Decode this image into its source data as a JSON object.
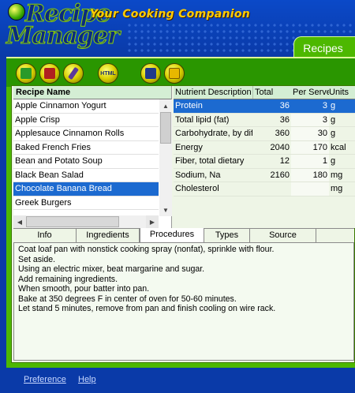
{
  "app": {
    "title_line1": "Recipe",
    "title_line2": "Manager",
    "tagline": "Your Cooking Companion",
    "tab_label": "Recipes"
  },
  "toolbar": {
    "buttons": [
      {
        "icon": "add-recipe-icon",
        "glyph_color": "#2a9a2a"
      },
      {
        "icon": "delete-recipe-icon",
        "glyph_color": "#b02020"
      },
      {
        "icon": "edit-recipe-icon",
        "glyph_color": "#5a3a9a"
      },
      {
        "icon": "html-export-icon",
        "label": "HTML"
      },
      {
        "icon": "save-icon",
        "glyph_color": "#203a8a"
      },
      {
        "icon": "open-folder-icon",
        "glyph_color": "#e0b000"
      }
    ]
  },
  "recipes": {
    "header": "Recipe Name",
    "items": [
      "Apple Cinnamon Yogurt",
      "Apple Crisp",
      "Applesauce Cinnamon Rolls",
      "Baked French Fries",
      "Bean and Potato Soup",
      "Black Bean Salad",
      "Chocolate Banana Bread",
      "Greek Burgers"
    ],
    "selected_index": 6
  },
  "nutrients": {
    "headers": {
      "desc": "Nutrient Description",
      "total": "Total",
      "perserve": "Per Serve",
      "units": "Units"
    },
    "rows": [
      {
        "desc": "Protein",
        "total": "36",
        "perserve": "3",
        "units": "g"
      },
      {
        "desc": "Total lipid (fat)",
        "total": "36",
        "perserve": "3",
        "units": "g"
      },
      {
        "desc": "Carbohydrate, by diffe",
        "total": "360",
        "perserve": "30",
        "units": "g"
      },
      {
        "desc": "Energy",
        "total": "2040",
        "perserve": "170",
        "units": "kcal"
      },
      {
        "desc": "Fiber, total dietary",
        "total": "12",
        "perserve": "1",
        "units": "g"
      },
      {
        "desc": "Sodium, Na",
        "total": "2160",
        "perserve": "180",
        "units": "mg"
      },
      {
        "desc": "Cholesterol",
        "total": "",
        "perserve": "",
        "units": "mg"
      }
    ],
    "selected_index": 0
  },
  "tabs": {
    "items": [
      "Info",
      "Ingredients",
      "Procedures",
      "Types",
      "Source"
    ],
    "active_index": 2
  },
  "procedures": {
    "lines": [
      "Coat loaf pan with nonstick cooking spray (nonfat), sprinkle with flour.",
      "Set aside.",
      "Using an electric mixer, beat margarine and sugar.",
      "Add remaining ingredients.",
      "When smooth, pour batter into pan.",
      "Bake at 350 degrees F in center of oven for 50-60 minutes.",
      "Let stand 5 minutes, remove from pan and finish cooling on wire rack."
    ]
  },
  "footer": {
    "preference": "Preference",
    "help": "Help"
  }
}
